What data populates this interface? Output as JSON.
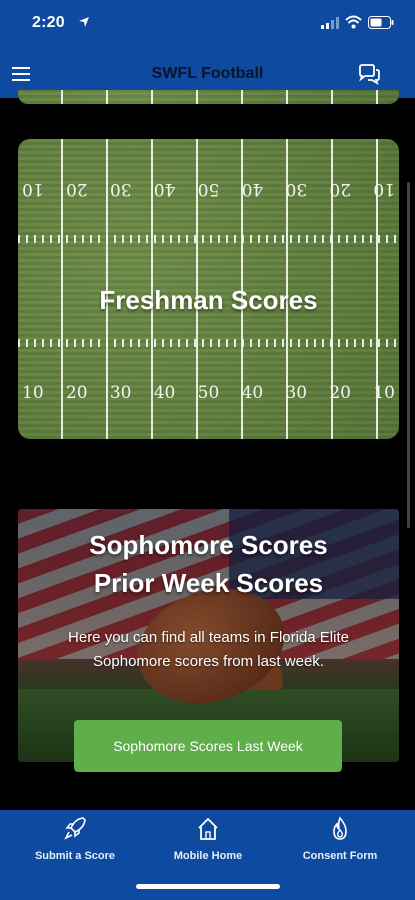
{
  "status_bar": {
    "time": "2:20"
  },
  "header": {
    "title": "SWFL Football"
  },
  "cards": [
    {
      "title": "Freshman Scores",
      "yard_numbers_top": [
        "10",
        "20",
        "30",
        "40",
        "50",
        "40",
        "30",
        "20",
        "10"
      ],
      "yard_numbers_bottom": [
        "10",
        "20",
        "30",
        "40",
        "50",
        "40",
        "30",
        "20",
        "10"
      ]
    },
    {
      "title_line1": "Sophomore Scores",
      "title_line2": "Prior Week Scores",
      "description": "Here you can find all teams in Florida Elite Sophomore scores from last week.",
      "button_label": "Sophomore Scores Last Week"
    }
  ],
  "bottom_nav": [
    {
      "label": "Submit a Score",
      "icon": "rocket-icon"
    },
    {
      "label": "Mobile Home",
      "icon": "home-icon"
    },
    {
      "label": "Consent Form",
      "icon": "flame-icon"
    }
  ],
  "colors": {
    "brand_blue": "#0d4aa0",
    "button_green": "#5fae4a"
  }
}
